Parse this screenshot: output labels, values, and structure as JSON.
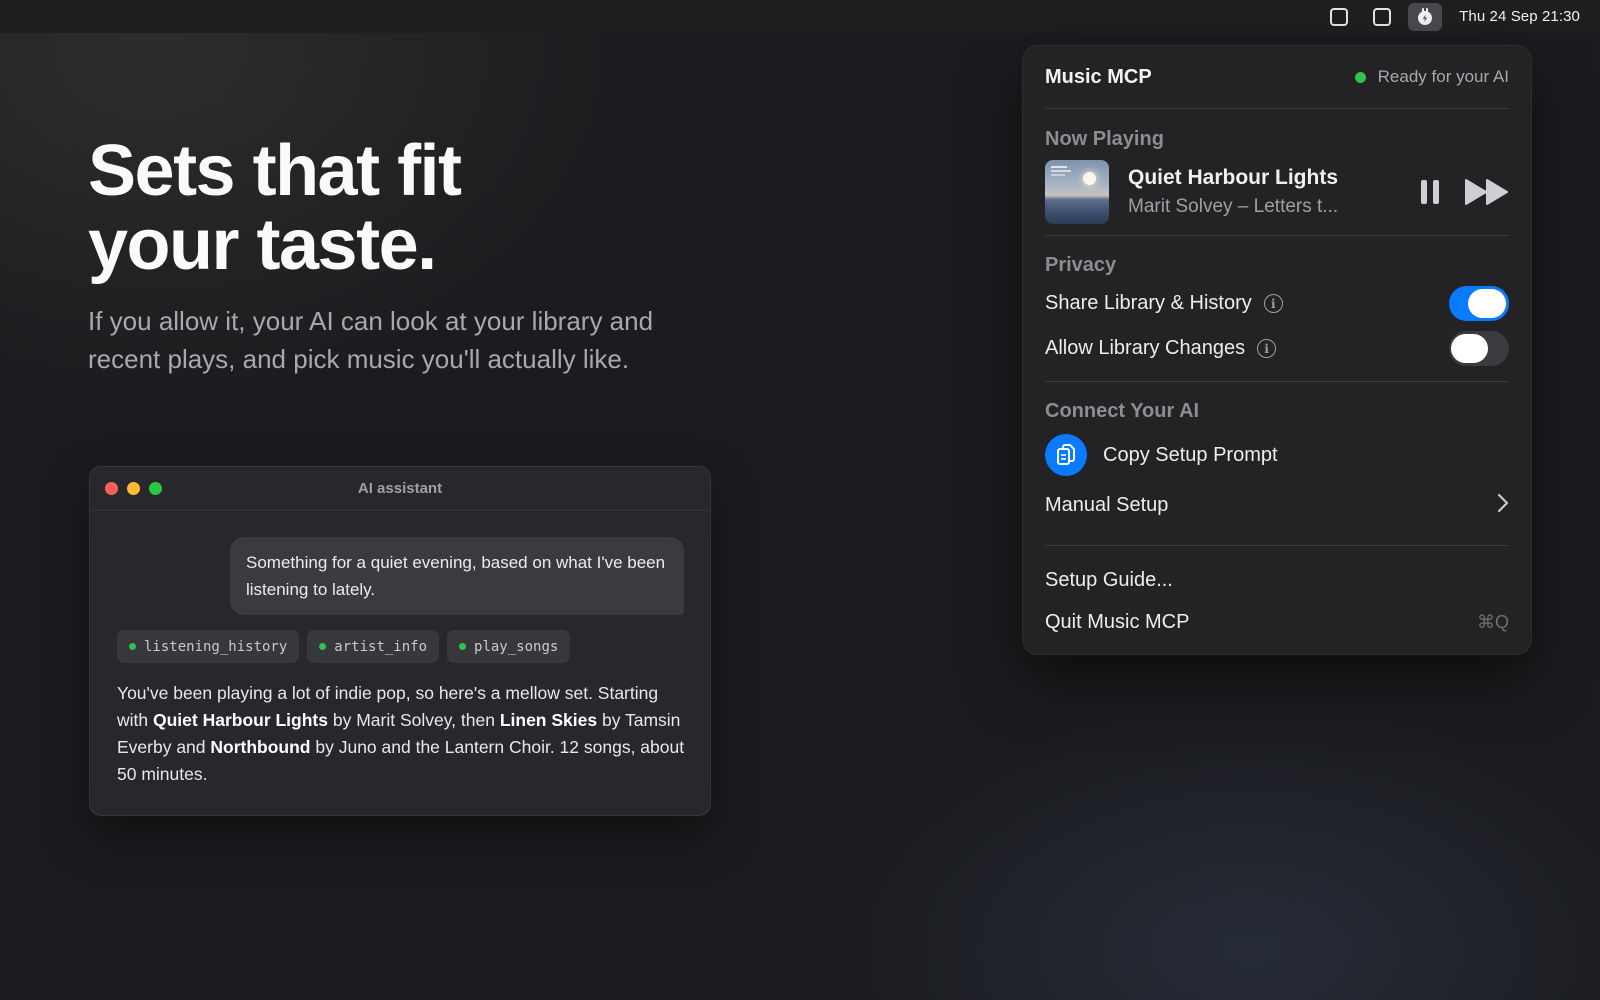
{
  "menubar": {
    "icons": [
      "window-icon",
      "window-icon",
      "plug-icon"
    ],
    "clock": "Thu 24 Sep  21:30"
  },
  "hero": {
    "title_line1": "Sets that fit",
    "title_line2": "your taste.",
    "subtitle": "If you allow it, your AI can look at your library and recent plays, and pick music you'll actually like."
  },
  "chat": {
    "window_title": "AI assistant",
    "user_message": "Something for a quiet evening, based on what I've been listening to lately.",
    "tool_calls": [
      "listening_history",
      "artist_info",
      "play_songs"
    ],
    "reply": {
      "p1": "You've been playing a lot of indie pop, so here's a mellow set. Starting with ",
      "b1": "Quiet Harbour Lights",
      "p2": " by Marit Solvey, then ",
      "b2": "Linen Skies",
      "p3": " by Tamsin Everby and ",
      "b3": "Northbound",
      "p4": " by Juno and the Lantern Choir. 12 songs, about 50 minutes."
    }
  },
  "popover": {
    "title": "Music MCP",
    "status": "Ready for your AI",
    "status_color": "#30c24f",
    "now_playing": {
      "heading": "Now Playing",
      "track": "Quiet Harbour Lights",
      "artist_album": "Marit Solvey – Letters t..."
    },
    "privacy": {
      "heading": "Privacy",
      "share_label": "Share Library & History",
      "share_on": true,
      "changes_label": "Allow Library Changes",
      "changes_on": false
    },
    "connect": {
      "heading": "Connect Your AI",
      "copy_label": "Copy Setup Prompt",
      "manual_label": "Manual Setup"
    },
    "footer": {
      "guide_label": "Setup Guide...",
      "quit_label": "Quit Music MCP",
      "quit_shortcut": "⌘Q"
    },
    "accent_color": "#0a7bff"
  }
}
